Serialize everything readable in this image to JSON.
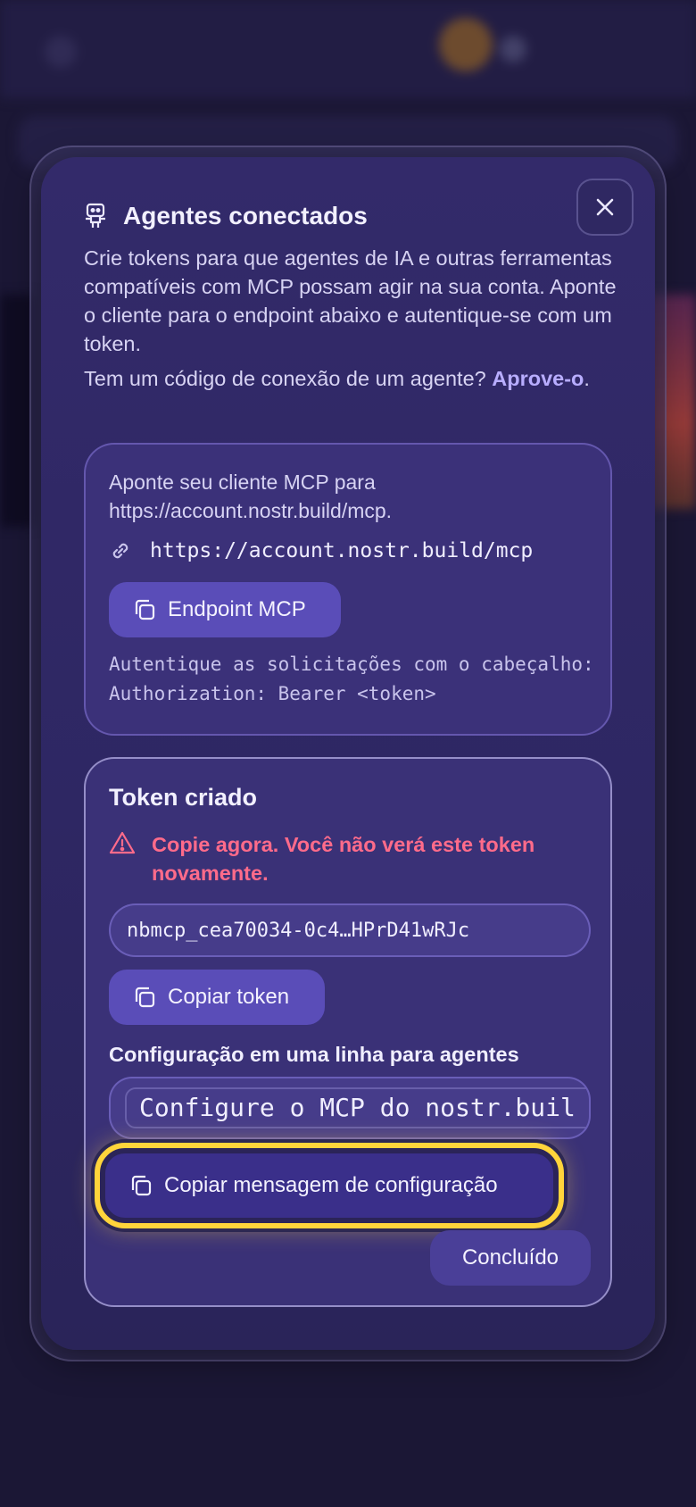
{
  "modal": {
    "title": "Agentes conectados",
    "description": "Crie tokens para que agentes de IA e outras ferramentas compatíveis com MCP possam agir na sua conta. Aponte o cliente para o endpoint abaixo e autentique-se com um token.",
    "approve_prompt": "Tem um código de conexão de um agente?",
    "approve_link": "Aprove-o",
    "approve_suffix": ".",
    "close_icon": "close-icon",
    "title_icon": "robot-icon"
  },
  "endpoint_card": {
    "text": "Aponte seu cliente MCP para https://account.nostr.build/mcp.",
    "url": "https://account.nostr.build/mcp",
    "copy_button": "Endpoint MCP",
    "auth_note": "Autentique as solicitações com o cabeçalho: Authorization: Bearer <token>"
  },
  "token_card": {
    "title": "Token criado",
    "warning": "Copie agora. Você não verá este token novamente.",
    "token_value": "nbmcp_cea70034-0c4…HPrD41wRJc",
    "copy_token_button": "Copiar token",
    "oneline_label": "Configuração em uma linha para agentes",
    "oneline_value": "Configure o MCP do nostr.buil",
    "copy_config_button": "Copiar mensagem de configuração",
    "done_button": "Concluído"
  },
  "colors": {
    "accent": "#5a4db8",
    "warning": "#ff6b8a",
    "highlight": "#ffd43b"
  }
}
